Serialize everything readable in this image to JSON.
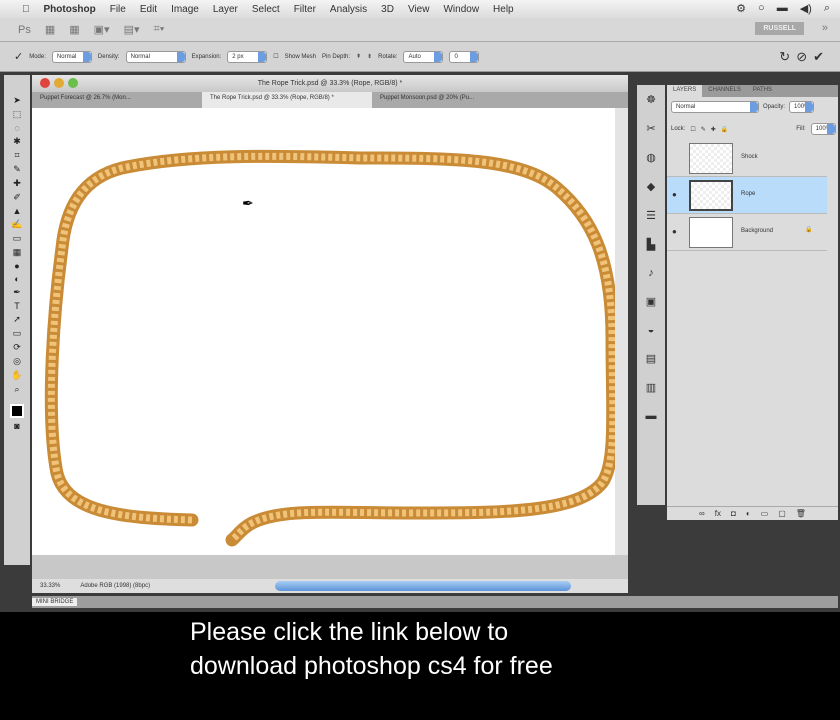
{
  "menubar": {
    "app": "Photoshop",
    "items": [
      "File",
      "Edit",
      "Image",
      "Layer",
      "Select",
      "Filter",
      "Analysis",
      "3D",
      "View",
      "Window",
      "Help"
    ]
  },
  "appbar": {
    "logo": "Ps",
    "user": "RUSSELL"
  },
  "options": {
    "mode_label": "Mode:",
    "mode": "Normal",
    "density_label": "Density:",
    "density": "Normal",
    "expansion_label": "Expansion:",
    "expansion": "2 px",
    "show_mesh": "Show Mesh",
    "pin_depth": "Pin Depth:",
    "rotate_label": "Rotate:",
    "rotate": "Auto",
    "angle": "0"
  },
  "document": {
    "title": "The Rope Trick.psd @ 33.3% (Rope, RGB/8) *",
    "tabs": [
      "Puppet Forecast @ 26.7% (Mon...",
      "The Rope Trick.psd @ 33.3% (Rope, RGB/8) *",
      "Puppet Monsoon.psd @ 20% (Pu..."
    ],
    "zoom": "33.33%",
    "profile": "Adobe RGB (1998) (8bpc)"
  },
  "layers": {
    "tabs": [
      "LAYERS",
      "CHANNELS",
      "PATHS"
    ],
    "blend": "Normal",
    "opacity_label": "Opacity:",
    "opacity": "100%",
    "lock_label": "Lock:",
    "fill_label": "Fill:",
    "fill": "100%",
    "items": [
      {
        "name": "Shock"
      },
      {
        "name": "Rope"
      },
      {
        "name": "Background"
      }
    ]
  },
  "minibridge": "MINI BRIDGE",
  "caption": {
    "line1": "Please click the link below to",
    "line2": "download photoshop cs4 for free"
  },
  "colors": {
    "rope": "#d9a04a",
    "selection": "#b9dcfa"
  }
}
